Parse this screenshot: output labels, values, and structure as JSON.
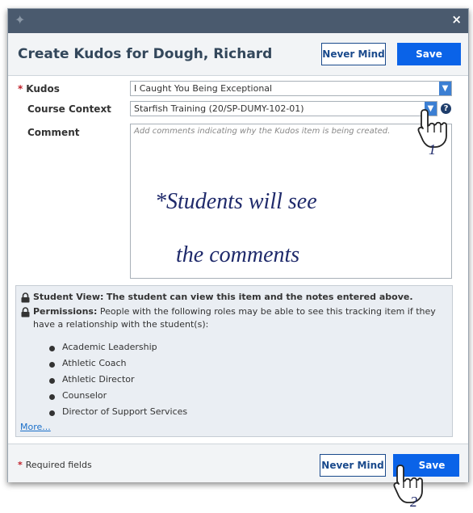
{
  "dialog": {
    "title": "Create Kudos for Dough, Richard",
    "never_mind_label": "Never Mind",
    "save_label": "Save",
    "close_symbol": "×",
    "pin_symbol": "✦"
  },
  "form": {
    "kudos_label": "Kudos",
    "kudos_value": "I Caught You Being Exceptional",
    "course_context_label": "Course Context",
    "course_context_value": "Starfish Training (20/SP-DUMY-102-01)",
    "help_symbol": "?",
    "comment_label": "Comment",
    "comment_placeholder": "Add comments indicating why the Kudos item is being created.",
    "required_marker": "*"
  },
  "annotation": {
    "line1": "*Students will see",
    "line2": "the comments",
    "step1": "1",
    "step2": "2"
  },
  "permissions": {
    "student_view_label": "Student View:",
    "student_view_text": "The student can view this item and the notes entered above.",
    "permissions_label": "Permissions:",
    "permissions_text": "People with the following roles may be able to see this tracking item if they have a relationship with the student(s):",
    "roles": [
      "Academic Leadership",
      "Athletic Coach",
      "Athletic Director",
      "Counselor",
      "Director of Support Services"
    ],
    "more_link": "More..."
  },
  "footer": {
    "required_text": "Required fields",
    "never_mind_label": "Never Mind",
    "save_label": "Save"
  },
  "colors": {
    "titlebar": "#4a5a6e",
    "primary_button": "#0a63e8",
    "annotation_text": "#1f2a6b",
    "required_star": "#c0202a"
  }
}
